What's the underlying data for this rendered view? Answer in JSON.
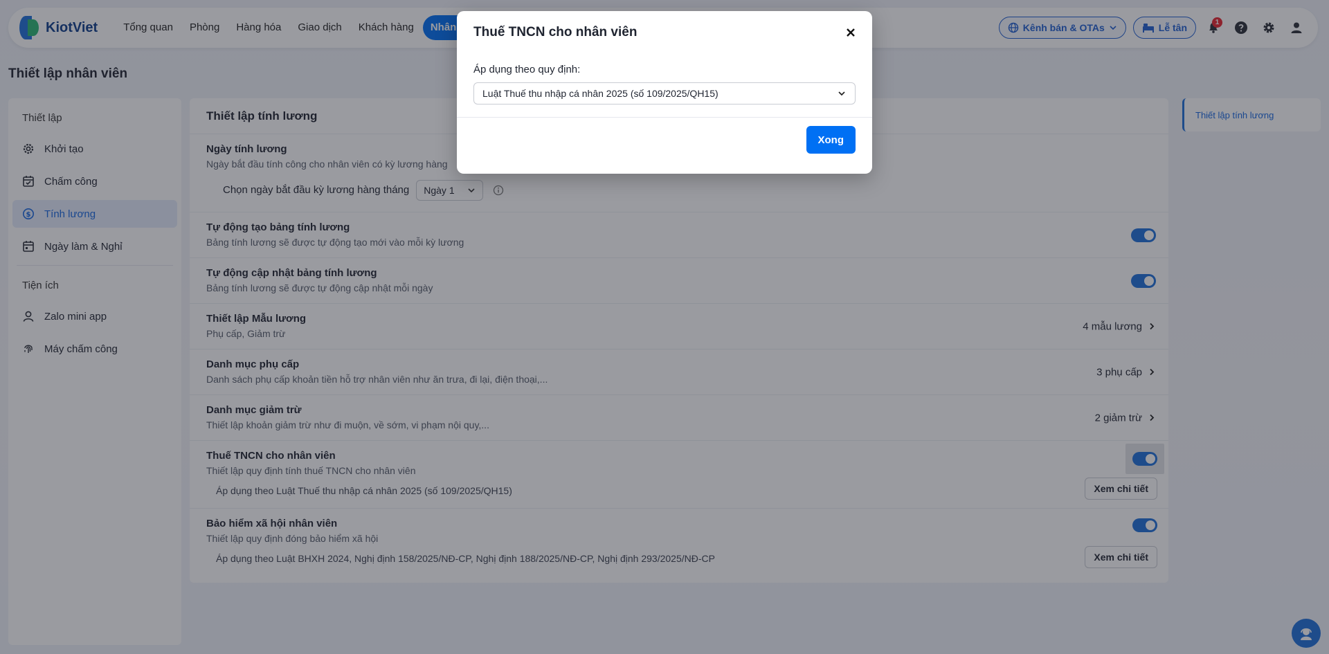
{
  "header": {
    "logo_text": "KiotViet",
    "nav": [
      "Tổng quan",
      "Phòng",
      "Hàng hóa",
      "Giao dịch",
      "Khách hàng",
      "Nhân v"
    ],
    "channel_button": "Kênh bán & OTAs",
    "reception_button": "Lễ tân",
    "notification_count": "1"
  },
  "page": {
    "title": "Thiết lập nhân viên"
  },
  "sidebar": {
    "section1": "Thiết lập",
    "items1": [
      "Khởi tạo",
      "Chấm công",
      "Tính lương",
      "Ngày làm & Nghỉ"
    ],
    "section2": "Tiện ích",
    "items2": [
      "Zalo mini app",
      "Máy chấm công"
    ]
  },
  "main": {
    "title": "Thiết lập tính lương",
    "payday": {
      "title": "Ngày tính lương",
      "desc": "Ngày bắt đầu tính công cho nhân viên có kỳ lương hàng",
      "choose_label": "Chọn ngày bắt đầu kỳ lương hàng tháng",
      "choose_value": "Ngày 1"
    },
    "auto_create": {
      "title": "Tự động tạo bảng tính lương",
      "desc": "Bảng tính lương sẽ được tự động tạo mới vào mỗi kỳ lương"
    },
    "auto_update": {
      "title": "Tự động cập nhật bảng tính lương",
      "desc": "Bảng tính lương sẽ được tự động cập nhật mỗi ngày"
    },
    "salary_template": {
      "title": "Thiết lập Mẫu lương",
      "desc": "Phụ cấp, Giảm trừ",
      "value": "4 mẫu lương"
    },
    "allowance": {
      "title": "Danh mục phụ cấp",
      "desc": "Danh sách phụ cấp khoản tiền hỗ trợ nhân viên như ăn trưa, đi lại, điện thoại,...",
      "value": "3 phụ cấp"
    },
    "deduction": {
      "title": "Danh mục giảm trừ",
      "desc": "Thiết lập khoản giảm trừ như đi muộn, về sớm, vi phạm nội quy,...",
      "value": "2 giảm trừ"
    },
    "pit": {
      "title": "Thuế TNCN cho nhân viên",
      "desc": "Thiết lập quy định tính thuế TNCN cho nhân viên",
      "sub": "Áp dụng theo Luật Thuế thu nhập cá nhân 2025 (số 109/2025/QH15)",
      "button": "Xem chi tiết"
    },
    "insurance": {
      "title": "Bảo hiểm xã hội nhân viên",
      "desc": "Thiết lập quy định đóng bảo hiểm xã hội",
      "sub": "Áp dụng theo Luật BHXH 2024, Nghị định 158/2025/NĐ-CP, Nghị định 188/2025/NĐ-CP, Nghị định 293/2025/NĐ-CP",
      "button": "Xem chi tiết"
    }
  },
  "right_panel": {
    "link": "Thiết lập tính lương"
  },
  "modal": {
    "title": "Thuế TNCN cho nhân viên",
    "label": "Áp dụng theo quy định:",
    "select_value": "Luật Thuế thu nhập cá nhân 2025 (số 109/2025/QH15)",
    "done_button": "Xong"
  },
  "colors": {
    "accent": "#0070f4",
    "toggle": "#1e6fd9"
  }
}
